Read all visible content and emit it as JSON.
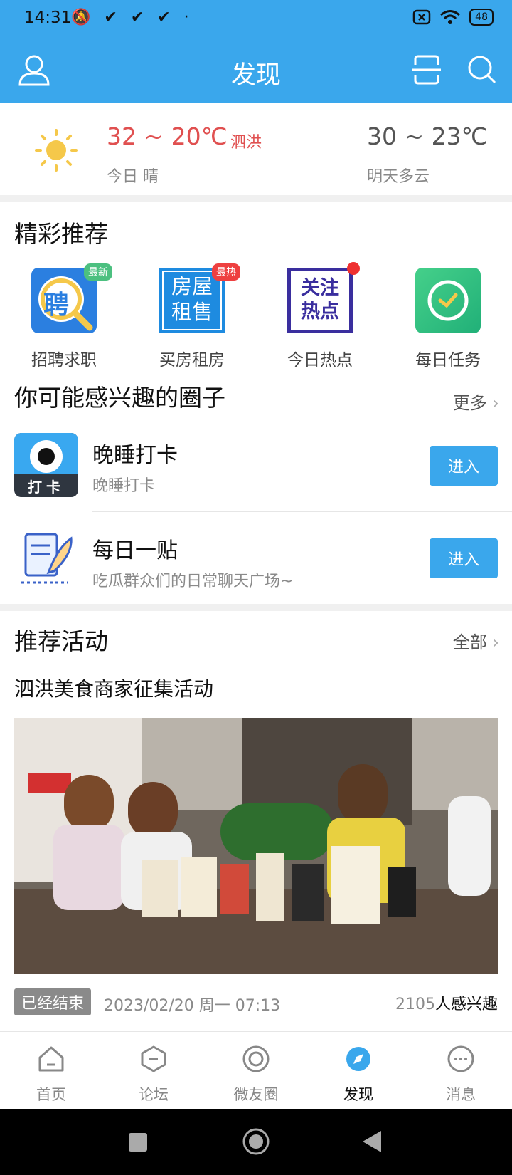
{
  "status_bar": {
    "time": "14:31",
    "notification_icons": "🔕 ✔ ✔ ✔ ·",
    "battery": "48"
  },
  "header": {
    "title": "发现",
    "left_icon": "user-icon",
    "right_icons": [
      "scan-icon",
      "search-icon"
    ],
    "color": "#3aa7ec"
  },
  "weather": {
    "today_range": "32 ~ 20℃",
    "city": "泗洪",
    "today_label": "今日 晴",
    "tomorrow_range": "30 ~ 23℃",
    "tomorrow_label": "明天多云"
  },
  "recommend": {
    "title": "精彩推荐",
    "items": [
      {
        "label": "招聘求职",
        "icon_text": "聘",
        "badge": "最新",
        "icon": "recruit-icon"
      },
      {
        "label": "买房租房",
        "icon_text_1": "房屋",
        "icon_text_2": "租售",
        "badge": "最热",
        "icon": "house-icon"
      },
      {
        "label": "今日热点",
        "icon_text_1": "关注",
        "icon_text_2": "热点",
        "icon": "hotspot-icon"
      },
      {
        "label": "每日任务",
        "icon": "clock-icon"
      }
    ]
  },
  "circles": {
    "title": "你可能感兴趣的圈子",
    "more": "更多",
    "items": [
      {
        "name": "晚睡打卡",
        "desc": "晚睡打卡",
        "icon_caption": "打卡",
        "button": "进入"
      },
      {
        "name": "每日一贴",
        "desc": "吃瓜群众们的日常聊天广场~",
        "button": "进入"
      }
    ]
  },
  "activities": {
    "title": "推荐活动",
    "all": "全部",
    "item": {
      "title": "泗洪美食商家征集活动",
      "status": "已经结束",
      "datetime": "2023/02/20 周一 07:13",
      "interest_count": "2105",
      "interest_label": "人感兴趣"
    }
  },
  "tabs": [
    {
      "label": "首页",
      "icon": "home-icon"
    },
    {
      "label": "论坛",
      "icon": "forum-icon"
    },
    {
      "label": "微友圈",
      "icon": "moments-icon"
    },
    {
      "label": "发现",
      "icon": "discover-icon",
      "active": true
    },
    {
      "label": "消息",
      "icon": "message-icon"
    }
  ]
}
